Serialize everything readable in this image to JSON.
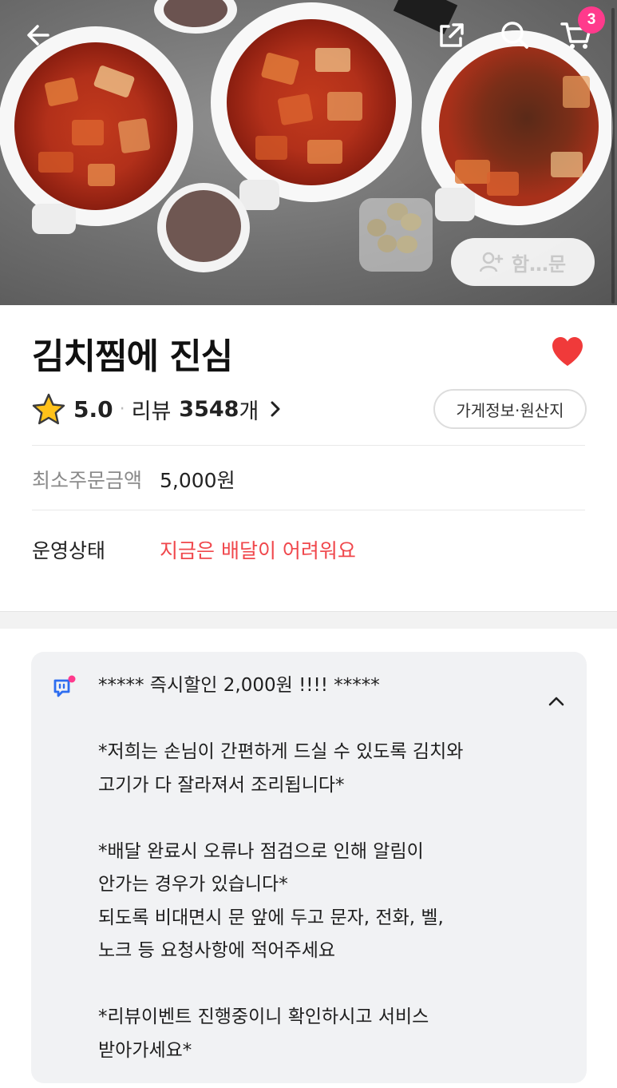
{
  "hero": {
    "cart_count": "3",
    "group_order_label": "함…문"
  },
  "store": {
    "name": "김치찜에 진심",
    "rating": "5.0",
    "review_label": "리뷰",
    "review_count": "3548",
    "review_unit": "개",
    "info_button": "가게정보·원산지",
    "favorited": true
  },
  "details": [
    {
      "label": "최소주문금액",
      "value": "5,000원"
    },
    {
      "label": "운영상태",
      "value": "지금은 배달이 어려워요"
    }
  ],
  "notice": {
    "lines": [
      "***** 즉시할인 2,000원 !!!! *****",
      "",
      "*저희는 손님이 간편하게 드실 수 있도록 김치와",
      "고기가 다 잘라져서 조리됩니다*",
      "",
      "*배달 완료시 오류나 점검으로 인해 알림이",
      "안가는 경우가 있습니다*",
      "되도록 비대면시 문 앞에 두고 문자, 전화, 벨,",
      "노크 등 요청사항에 적어주세요",
      "",
      "*리뷰이벤트 진행중이니 확인하시고 서비스",
      "받아가세요*"
    ]
  },
  "icons": {
    "back": "back-arrow-icon",
    "share": "share-icon",
    "search": "search-icon",
    "cart": "cart-icon",
    "heart": "heart-icon",
    "star": "star-icon",
    "notice": "notice-icon"
  },
  "colors": {
    "badge": "#ff3a8c",
    "heart": "#f03a3a",
    "status_warning": "#f0474c",
    "star_fill": "#ffc21a",
    "notice_icon": "#2d6df0"
  }
}
